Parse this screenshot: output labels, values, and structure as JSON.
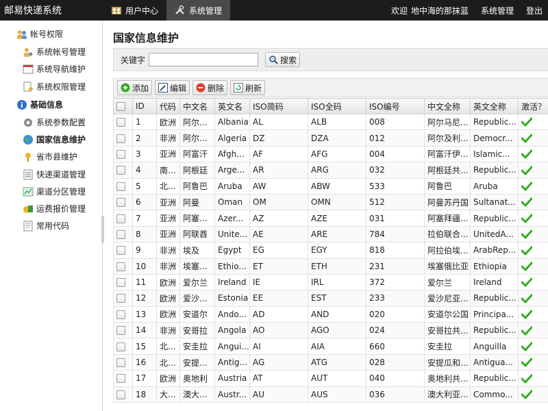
{
  "app": {
    "title": "邮易快递系统"
  },
  "topnav": {
    "tabs": [
      {
        "label": "用户中心"
      },
      {
        "label": "系统管理"
      }
    ],
    "welcome": "欢迎",
    "username": "地中海的那抹蓝",
    "settings": "系统管理",
    "logout": "登出"
  },
  "sidebar": {
    "sections": [
      {
        "label": "帐号权限",
        "items": [
          {
            "label": "系统帐号管理"
          },
          {
            "label": "系统导航维护"
          },
          {
            "label": "系统权限管理"
          }
        ]
      },
      {
        "label": "基础信息",
        "items": [
          {
            "label": "系统参数配置"
          },
          {
            "label": "国家信息维护"
          },
          {
            "label": "省市县维护"
          },
          {
            "label": "快递渠道管理"
          },
          {
            "label": "渠道分区管理"
          },
          {
            "label": "运费报价管理"
          },
          {
            "label": "常用代码"
          }
        ]
      }
    ]
  },
  "main": {
    "title": "国家信息维护",
    "search": {
      "label": "关键字",
      "value": "",
      "placeholder": "",
      "button": "搜索"
    },
    "toolbar": {
      "add": "添加",
      "edit": "编辑",
      "delete": "删除",
      "refresh": "刷新"
    },
    "table": {
      "headers": [
        "ID",
        "代码",
        "中文名",
        "英文名",
        "ISO简码",
        "ISO全码",
        "ISO编号",
        "中文全称",
        "英文全称",
        "激活？"
      ],
      "rows": [
        [
          "1",
          "欧洲",
          "阿尔...",
          "Albania",
          "AL",
          "ALB",
          "008",
          "阿尔马尼...",
          "Republic..."
        ],
        [
          "2",
          "非洲",
          "阿尔...",
          "Algeria",
          "DZ",
          "DZA",
          "012",
          "阿尔及利...",
          "Democr..."
        ],
        [
          "3",
          "亚洲",
          "阿富汗",
          "Afgh...",
          "AF",
          "AFG",
          "004",
          "阿富汗伊...",
          "Islamic..."
        ],
        [
          "4",
          "南...",
          "阿根廷",
          "Arge...",
          "AR",
          "ARG",
          "032",
          "阿根廷共...",
          "Republic..."
        ],
        [
          "5",
          "北...",
          "阿鲁巴",
          "Aruba",
          "AW",
          "ABW",
          "533",
          "阿鲁巴",
          "Aruba"
        ],
        [
          "6",
          "亚洲",
          "阿曼",
          "Oman",
          "OM",
          "OMN",
          "512",
          "阿曼苏丹国",
          "Sultanat..."
        ],
        [
          "7",
          "亚洲",
          "阿塞...",
          "Azer...",
          "AZ",
          "AZE",
          "031",
          "阿塞拜疆...",
          "Republic..."
        ],
        [
          "8",
          "亚洲",
          "阿联酋",
          "Unite...",
          "AE",
          "ARE",
          "784",
          "拉伯联合...",
          "UnitedA..."
        ],
        [
          "9",
          "非洲",
          "埃及",
          "Egypt",
          "EG",
          "EGY",
          "818",
          "阿拉伯埃...",
          "ArabRep..."
        ],
        [
          "10",
          "非洲",
          "埃塞...",
          "Ethio...",
          "ET",
          "ETH",
          "231",
          "埃塞俄比亚",
          "Ethiopia"
        ],
        [
          "11",
          "欧洲",
          "爱尔兰",
          "Ireland",
          "IE",
          "IRL",
          "372",
          "爱尔兰",
          "Ireland"
        ],
        [
          "12",
          "欧洲",
          "爱沙...",
          "Estonia",
          "EE",
          "EST",
          "233",
          "爱沙尼亚...",
          "Republic..."
        ],
        [
          "13",
          "欧洲",
          "安道尔",
          "Ando...",
          "AD",
          "AND",
          "020",
          "安道尔公国",
          "Principa..."
        ],
        [
          "14",
          "非洲",
          "安哥拉",
          "Angola",
          "AO",
          "AGO",
          "024",
          "安哥拉共...",
          "Republic..."
        ],
        [
          "15",
          "北...",
          "安圭拉",
          "Angui...",
          "AI",
          "AIA",
          "660",
          "安圭拉",
          "Anguilla"
        ],
        [
          "16",
          "北...",
          "安提...",
          "Antig...",
          "AG",
          "ATG",
          "028",
          "安提瓜和...",
          "Antigua..."
        ],
        [
          "17",
          "欧洲",
          "奥地利",
          "Austria",
          "AT",
          "AUT",
          "040",
          "奥地利共...",
          "Republic..."
        ],
        [
          "18",
          "大...",
          "澳大...",
          "Austr...",
          "AU",
          "AUS",
          "036",
          "澳大利亚...",
          "Commo..."
        ]
      ]
    }
  },
  "colors": {
    "topbar": "#1c1c1c",
    "active_tab": "#4a4a4a",
    "check": "#3aa829"
  }
}
